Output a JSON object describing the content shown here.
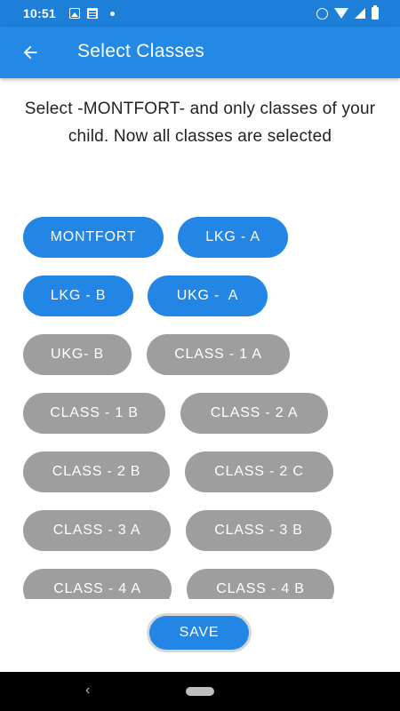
{
  "status_bar": {
    "time": "10:51",
    "left_icons": [
      "image-icon",
      "news-icon",
      "dot-icon"
    ],
    "right_icons": [
      "alarm-icon",
      "wifi-icon",
      "signal-icon",
      "battery-icon"
    ]
  },
  "app_bar": {
    "title": "Select Classes",
    "back_icon": "arrow-left-icon",
    "color": "#2488e5"
  },
  "instruction": "Select -MONTFORT- and only classes of your child. Now all classes are selected",
  "classes": [
    {
      "label": "MONTFORT",
      "selected": true
    },
    {
      "label": "LKG - A",
      "selected": true
    },
    {
      "label": "LKG - B",
      "selected": true
    },
    {
      "label": "UKG -  A",
      "selected": true
    },
    {
      "label": "UKG- B",
      "selected": false
    },
    {
      "label": "CLASS - 1 A",
      "selected": false
    },
    {
      "label": "CLASS - 1 B",
      "selected": false
    },
    {
      "label": "CLASS - 2 A",
      "selected": false
    },
    {
      "label": "CLASS - 2 B",
      "selected": false
    },
    {
      "label": "CLASS - 2 C",
      "selected": false
    },
    {
      "label": "CLASS - 3 A",
      "selected": false
    },
    {
      "label": "CLASS - 3 B",
      "selected": false
    },
    {
      "label": "CLASS - 4 A",
      "selected": false
    },
    {
      "label": "CLASS - 4 B",
      "selected": false
    }
  ],
  "colors": {
    "selected": "#2386e4",
    "unselected": "#9e9e9e"
  },
  "save_label": "SAVE",
  "nav_bar": {
    "back_icon": "nav-back-icon",
    "home_icon": "nav-home-pill-icon"
  }
}
